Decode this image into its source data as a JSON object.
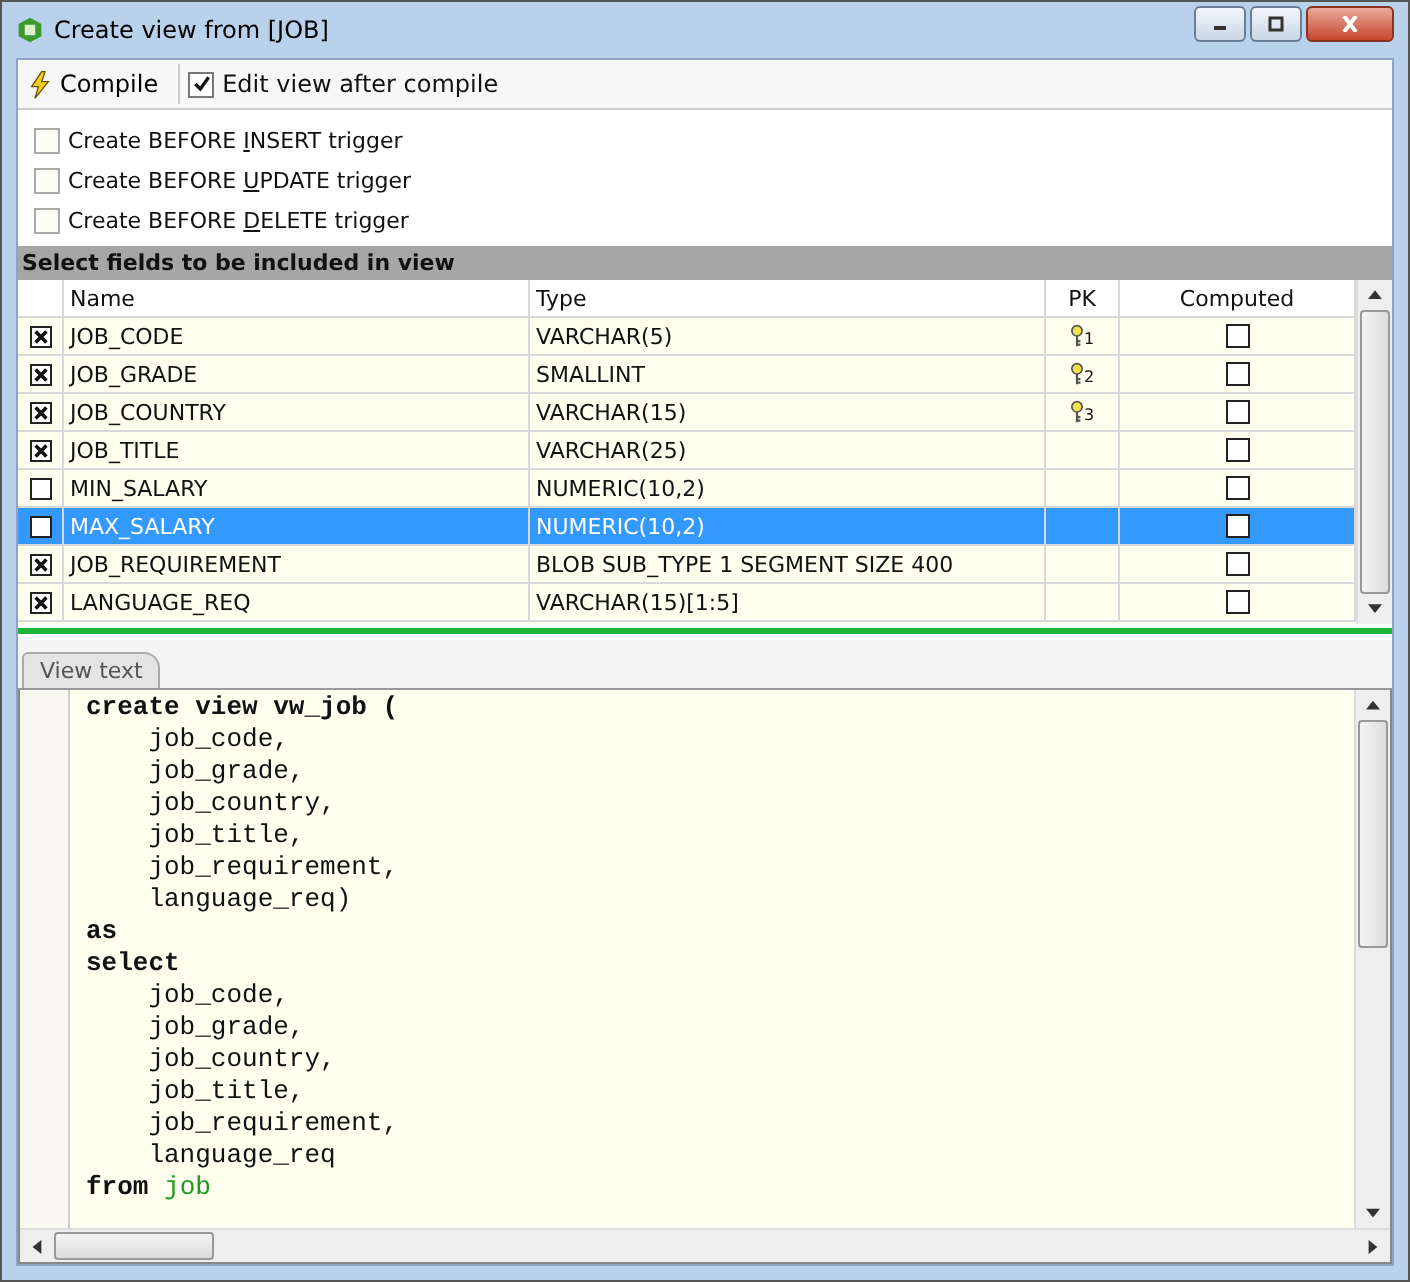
{
  "window": {
    "title": "Create view from [JOB]"
  },
  "toolbar": {
    "compile_label": "Compile",
    "edit_after_compile": {
      "label": "Edit view after compile",
      "checked": true
    }
  },
  "triggers": [
    {
      "label": "Create BEFORE **I**NSERT trigger",
      "checked": false
    },
    {
      "label": "Create BEFORE **U**PDATE trigger",
      "checked": false
    },
    {
      "label": "Create BEFORE **D**ELETE trigger",
      "checked": false
    }
  ],
  "fields": {
    "title": "Select fields to be included in view",
    "columns": [
      "Name",
      "Type",
      "PK",
      "Computed"
    ],
    "rows": [
      {
        "included": true,
        "name": "JOB_CODE",
        "type": "VARCHAR(5)",
        "pk": "1",
        "computed": false,
        "selected": false
      },
      {
        "included": true,
        "name": "JOB_GRADE",
        "type": "SMALLINT",
        "pk": "2",
        "computed": false,
        "selected": false
      },
      {
        "included": true,
        "name": "JOB_COUNTRY",
        "type": "VARCHAR(15)",
        "pk": "3",
        "computed": false,
        "selected": false
      },
      {
        "included": true,
        "name": "JOB_TITLE",
        "type": "VARCHAR(25)",
        "computed": false,
        "selected": false
      },
      {
        "included": false,
        "name": "MIN_SALARY",
        "type": "NUMERIC(10,2)",
        "computed": false,
        "selected": false
      },
      {
        "included": false,
        "name": "MAX_SALARY",
        "type": "NUMERIC(10,2)",
        "computed": false,
        "selected": true
      },
      {
        "included": true,
        "name": "JOB_REQUIREMENT",
        "type": "BLOB SUB_TYPE 1 SEGMENT SIZE 400",
        "computed": false,
        "selected": false
      },
      {
        "included": true,
        "name": "LANGUAGE_REQ",
        "type": "VARCHAR(15)[1:5]",
        "computed": false,
        "selected": false
      }
    ]
  },
  "tabs": [
    {
      "label": "View text",
      "selected": true
    }
  ],
  "code_lines": [
    [
      {
        "text": "create view vw_job (",
        "kind": "keyword"
      }
    ],
    [
      {
        "text": "    job_code,",
        "kind": "plain"
      }
    ],
    [
      {
        "text": "    job_grade,",
        "kind": "plain"
      }
    ],
    [
      {
        "text": "    job_country,",
        "kind": "plain"
      }
    ],
    [
      {
        "text": "    job_title,",
        "kind": "plain"
      }
    ],
    [
      {
        "text": "    job_requirement,",
        "kind": "plain"
      }
    ],
    [
      {
        "text": "    language_req)",
        "kind": "plain"
      }
    ],
    [
      {
        "text": "as",
        "kind": "keyword"
      }
    ],
    [
      {
        "text": "select",
        "kind": "keyword"
      }
    ],
    [
      {
        "text": "    job_code,",
        "kind": "plain"
      }
    ],
    [
      {
        "text": "    job_grade,",
        "kind": "plain"
      }
    ],
    [
      {
        "text": "    job_country,",
        "kind": "plain"
      }
    ],
    [
      {
        "text": "    job_title,",
        "kind": "plain"
      }
    ],
    [
      {
        "text": "    job_requirement,",
        "kind": "plain"
      }
    ],
    [
      {
        "text": "    language_req",
        "kind": "plain"
      }
    ],
    [
      {
        "text": "from",
        "kind": "keyword"
      },
      {
        "text": " job",
        "kind": "table"
      }
    ]
  ]
}
